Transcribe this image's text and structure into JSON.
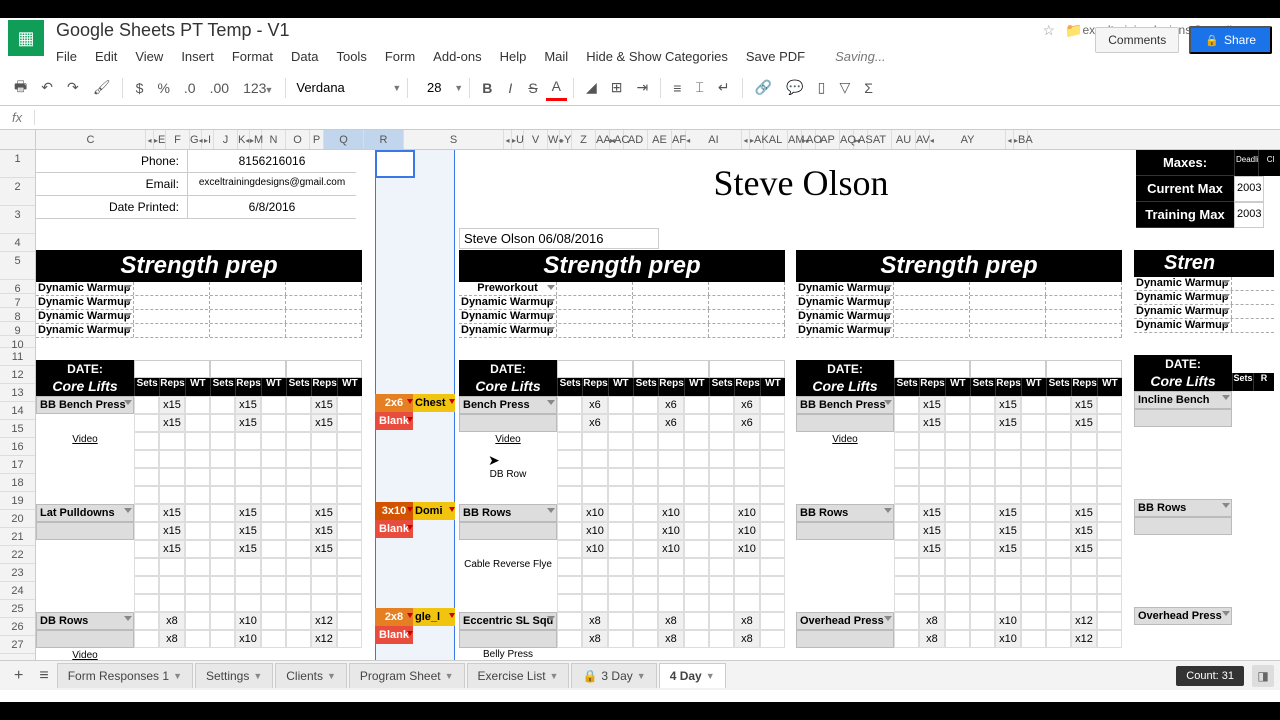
{
  "doc_title": "Google Sheets PT Temp - V1",
  "account_email": "exceltrainingdesigns@gmail.com",
  "buttons": {
    "comments": "Comments",
    "share": "Share"
  },
  "menu": [
    "File",
    "Edit",
    "View",
    "Insert",
    "Format",
    "Data",
    "Tools",
    "Form",
    "Add-ons",
    "Help",
    "Mail",
    "Hide & Show Categories",
    "Save PDF"
  ],
  "saving": "Saving...",
  "toolbar": {
    "font": "Verdana",
    "size": "28"
  },
  "col_letters": [
    "C",
    "",
    "E",
    "F",
    "G",
    "I",
    "J",
    "K",
    "M",
    "N",
    "O",
    "P",
    "Q",
    "R",
    "S",
    "",
    "U",
    "V",
    "W",
    "Y",
    "Z",
    "AA",
    "AC",
    "AD",
    "AE",
    "AF",
    "AI",
    "",
    "AK",
    "AL",
    "AM",
    "AO",
    "AP",
    "AQ",
    "AS",
    "AT",
    "AU",
    "AV",
    "AY",
    "",
    "BA"
  ],
  "info": {
    "phone_label": "Phone:",
    "phone": "8156216016",
    "email_label": "Email:",
    "email": "exceltrainingdesigns@gmail.com",
    "date_label": "Date Printed:",
    "date": "6/8/2016"
  },
  "client_name": "Steve Olson",
  "date_stamp": "Steve Olson 06/08/2016",
  "maxes": {
    "title": "Maxes:",
    "current": "Current Max",
    "training": "Training Max",
    "val": "2003"
  },
  "blocks": {
    "strength_prep": "Strength prep",
    "dynamic": "Dynamic Warmup",
    "preworkout": "Preworkout",
    "date": "DATE:",
    "core": "Core Lifts",
    "sets": "Sets",
    "reps": "Reps",
    "wt": "WT",
    "video": "Video"
  },
  "exercises": {
    "bb_bench": "BB Bench Press",
    "bench": "Bench Press",
    "incline": "Incline Bench",
    "lat_pull": "Lat Pulldowns",
    "bb_rows": "BB Rows",
    "db_rows": "DB Rows",
    "ecc_sl": "Eccentric SL Squ",
    "oh_press": "Overhead Press",
    "db_row_note": "DB Row",
    "cable_flye": "Cable Reverse Flye",
    "belly": "Belly Press"
  },
  "rep_vals": {
    "x15": "x15",
    "x6": "x6",
    "x10": "x10",
    "x8": "x8",
    "x12": "x12"
  },
  "pickers": {
    "p1a": "2x6",
    "p1b": "Chest",
    "blank": "Blank",
    "p2a": "3x10",
    "p2b": "Domi",
    "p3a": "2x8",
    "p3b": "gle_l"
  },
  "tabs": [
    "Form Responses 1",
    "Settings",
    "Clients",
    "Program Sheet",
    "Exercise List",
    "3 Day",
    "4 Day"
  ],
  "count": "Count: 31"
}
